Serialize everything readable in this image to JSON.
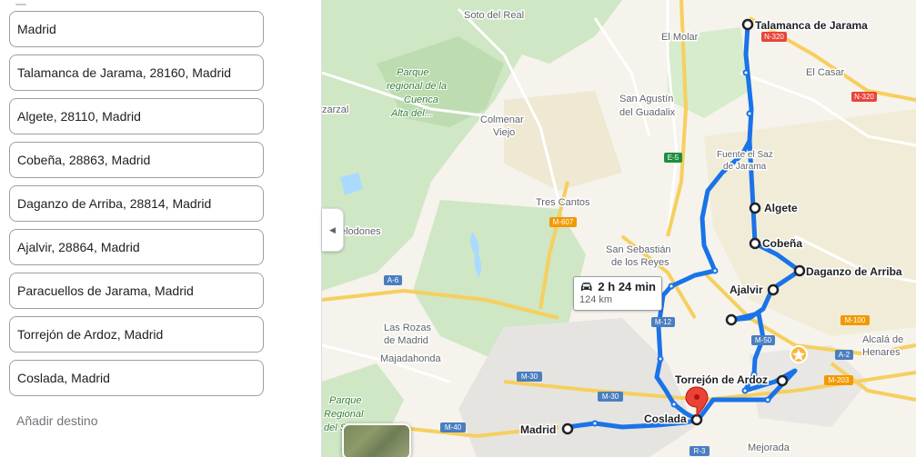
{
  "stops": [
    {
      "value": "Madrid"
    },
    {
      "value": "Talamanca de Jarama, 28160, Madrid"
    },
    {
      "value": "Algete, 28110, Madrid"
    },
    {
      "value": "Cobeña, 28863, Madrid"
    },
    {
      "value": "Daganzo de Arriba, 28814, Madrid"
    },
    {
      "value": "Ajalvir, 28864, Madrid"
    },
    {
      "value": "Paracuellos de Jarama, Madrid"
    },
    {
      "value": "Torrejón de Ardoz, Madrid"
    },
    {
      "value": "Coslada, Madrid"
    }
  ],
  "add_destination_label": "Añadir destino",
  "trip": {
    "time": "2 h 24 min",
    "distance": "124 km"
  },
  "map": {
    "place_labels": {
      "soto": "Soto del Real",
      "molar": "El Molar",
      "casar": "El Casar",
      "parque_line1": "Parque",
      "parque_line2": "regional de la",
      "parque_line3": "Cuenca",
      "parque_line4": "Alta del...",
      "zarzal": "zarzal",
      "colmenar_line1": "Colmenar",
      "colmenar_line2": "Viejo",
      "sanagustin_line1": "San Agustín",
      "sanagustin_line2": "del Guadalix",
      "fuente_line1": "Fuente el Saz",
      "fuente_line2": "de Jarama",
      "trescantos": "Tres Cantos",
      "galapagar": "elodones",
      "sanseb_line1": "San Sebastián",
      "sanseb_line2": "de los Reyes",
      "rozas_line1": "Las Rozas",
      "rozas_line2": "de Madrid",
      "majadahonda": "Majadahonda",
      "alcala_line1": "Alcalá de",
      "alcala_line2": "Henares",
      "mejorada": "Mejorada",
      "parque_sur_line1": "Parque",
      "parque_sur_line2": "Regional",
      "parque_sur_line3": "del Sur..."
    },
    "route_labels": {
      "talamanca": "Talamanca de Jarama",
      "algete": "Algete",
      "cobena": "Cobeña",
      "daganzo": "Daganzo de Arriba",
      "ajalvir": "Ajalvir",
      "torrejon": "Torrejón de Ardoz",
      "coslada": "Coslada",
      "madrid": "Madrid"
    },
    "shields": {
      "n320a": "N-320",
      "n320b": "N-320",
      "e5": "E-5",
      "m607": "M-607",
      "a6": "A-6",
      "m12": "M-12",
      "m100": "M-100",
      "m50": "M-50",
      "a2": "A-2",
      "m203": "M-203",
      "m30a": "M-30",
      "m30b": "M-30",
      "m40": "M-40",
      "r3": "R-3"
    },
    "route_color": "#1a73e8",
    "park_color": "#cfe7c4"
  }
}
